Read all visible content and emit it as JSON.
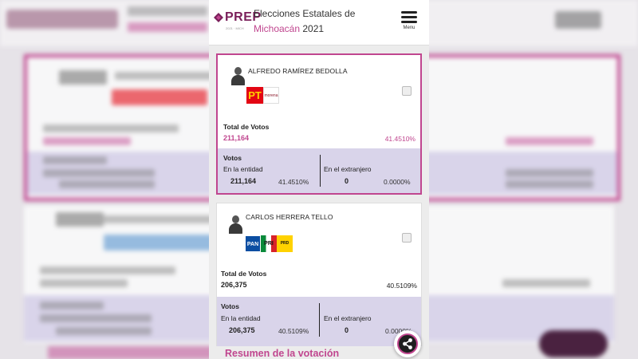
{
  "header": {
    "logo_text": "PREP",
    "logo_sub": "2021 · MICH",
    "title_line1": "Elecciones Estatales de",
    "title_accent": "Michoacán",
    "title_year": "2021",
    "menu_label": "Menu"
  },
  "candidates": [
    {
      "name": "ALFREDO RAMÍREZ BEDOLLA",
      "parties": [
        "PT",
        "morena"
      ],
      "total_label": "Total de Votos",
      "total_votes": "211,164",
      "total_pct": "41.4510%",
      "votos_label": "Votos",
      "entidad_label": "En la entidad",
      "entidad_votes": "211,164",
      "entidad_pct": "41.4510%",
      "extranjero_label": "En el extranjero",
      "extranjero_votes": "0",
      "extranjero_pct": "0.0000%",
      "selected": true
    },
    {
      "name": "CARLOS HERRERA TELLO",
      "parties": [
        "PAN",
        "PRI",
        "PRD"
      ],
      "total_label": "Total de Votos",
      "total_votes": "206,375",
      "total_pct": "40.5109%",
      "votos_label": "Votos",
      "entidad_label": "En la entidad",
      "entidad_votes": "206,375",
      "entidad_pct": "40.5109%",
      "extranjero_label": "En el extranjero",
      "extranjero_votes": "0",
      "extranjero_pct": "0.0000%",
      "selected": false
    }
  ],
  "summary_title": "Resumen de la votación",
  "colors": {
    "accent": "#c0468f",
    "panel_bg": "#d9d4ea",
    "brand_dark": "#7a1f5a"
  },
  "icons": {
    "menu": "hamburger-icon",
    "share": "share-icon"
  }
}
